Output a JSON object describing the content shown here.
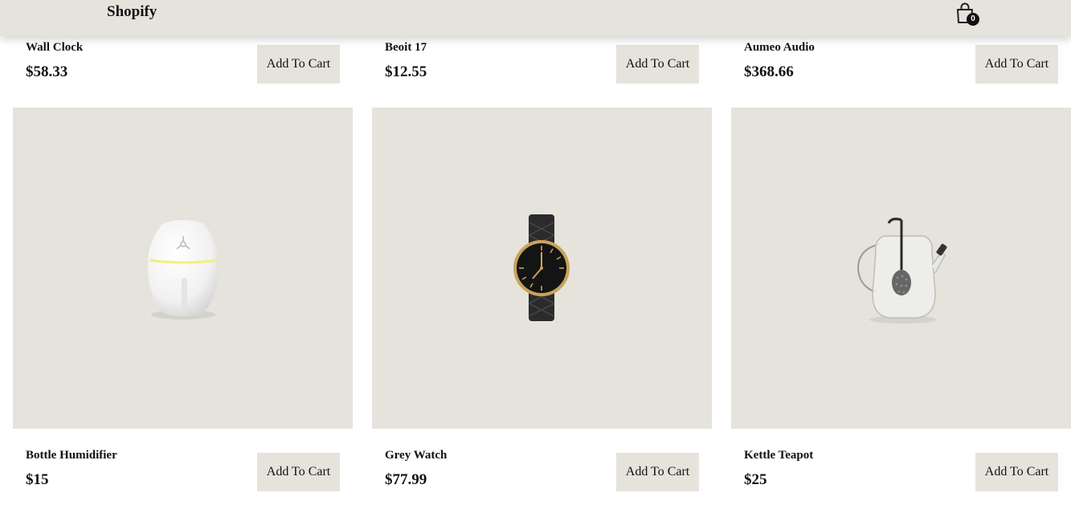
{
  "header": {
    "brand": "Shopify",
    "cart_icon": "shopping-bag-icon",
    "cart_count": "0"
  },
  "colors": {
    "header_bg": "#e5e3dc",
    "image_bg": "#e5e3dc",
    "button_bg": "#e5e3dc",
    "text": "#111111",
    "badge_bg": "#111111"
  },
  "add_to_cart_label": "Add To Cart",
  "products_top_row": [
    {
      "name": "Wall Clock",
      "price": "$58.33"
    },
    {
      "name": "Beoit 17",
      "price": "$12.55"
    },
    {
      "name": "Aumeo Audio",
      "price": "$368.66"
    }
  ],
  "products": [
    {
      "name": "Bottle Humidifier",
      "price": "$15",
      "image": "humidifier"
    },
    {
      "name": "Grey Watch",
      "price": "$77.99",
      "image": "wristwatch"
    },
    {
      "name": "Kettle Teapot",
      "price": "$25",
      "image": "glass-teapot"
    }
  ]
}
